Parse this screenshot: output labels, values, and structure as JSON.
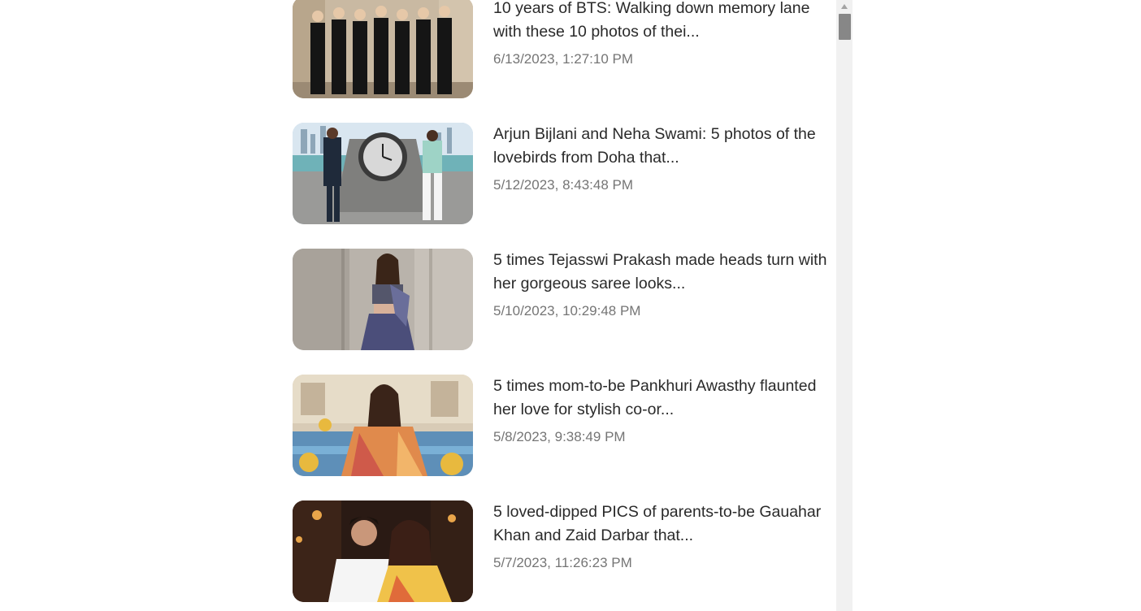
{
  "articles": [
    {
      "title": "10 years of BTS: Walking down memory lane with these 10 photos of thei...",
      "date": "6/13/2023, 1:27:10 PM",
      "thumbnail": "group-photo-in-suits"
    },
    {
      "title": "Arjun Bijlani and Neha Swami: 5 photos of the lovebirds from Doha that...",
      "date": "5/12/2023, 8:43:48 PM",
      "thumbnail": "couple-by-clock-sculpture"
    },
    {
      "title": "5 times Tejasswi Prakash made heads turn with her gorgeous saree looks...",
      "date": "5/10/2023, 10:29:48 PM",
      "thumbnail": "woman-in-saree"
    },
    {
      "title": "5 times mom-to-be Pankhuri Awasthy flaunted her love for stylish co-or...",
      "date": "5/8/2023, 9:38:49 PM",
      "thumbnail": "woman-in-floral-outfit"
    },
    {
      "title": "5 loved-dipped PICS of parents-to-be Gauahar Khan and Zaid Darbar that...",
      "date": "5/7/2023, 11:26:23 PM",
      "thumbnail": "couple-portrait"
    }
  ],
  "colors": {
    "headline": "#2a2a2a",
    "timestamp": "#757575",
    "scrollbar_track": "#f1f1f1",
    "scrollbar_thumb": "#878787"
  }
}
